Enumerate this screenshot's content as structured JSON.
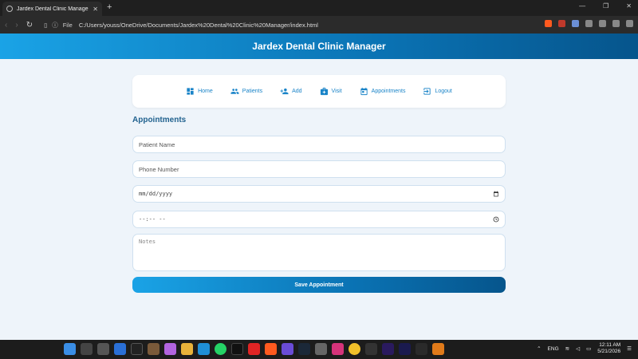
{
  "browser": {
    "tab_title": "Jardex Dental Clinic Manager",
    "address_scheme": "File",
    "address_url": "C:/Users/youss/OneDrive/Documents/Jardex%20Dental%20Clinic%20Manager/index.html"
  },
  "app": {
    "header_title": "Jardex Dental Clinic Manager",
    "nav": [
      {
        "label": "Home",
        "icon": "dashboard-icon"
      },
      {
        "label": "Patients",
        "icon": "people-icon"
      },
      {
        "label": "Add",
        "icon": "add-person-icon"
      },
      {
        "label": "Visit",
        "icon": "medical-kit-icon"
      },
      {
        "label": "Appointments",
        "icon": "calendar-icon"
      },
      {
        "label": "Logout",
        "icon": "logout-icon"
      }
    ],
    "section_title": "Appointments",
    "form": {
      "patient_name_placeholder": "Patient Name",
      "phone_placeholder": "Phone Number",
      "date_placeholder": "mm/dd/yyyy",
      "time_placeholder": "--:-- --",
      "notes_placeholder": "Notes",
      "save_label": "Save Appointment"
    }
  },
  "taskbar": {
    "language": "ENG",
    "time": "12:11 AM",
    "date": "5/21/2026"
  },
  "colors": {
    "accent": "#1a84c8",
    "header_gradient_start": "#1aa3e6",
    "header_gradient_end": "#06558c",
    "page_background": "#eef4fa"
  }
}
